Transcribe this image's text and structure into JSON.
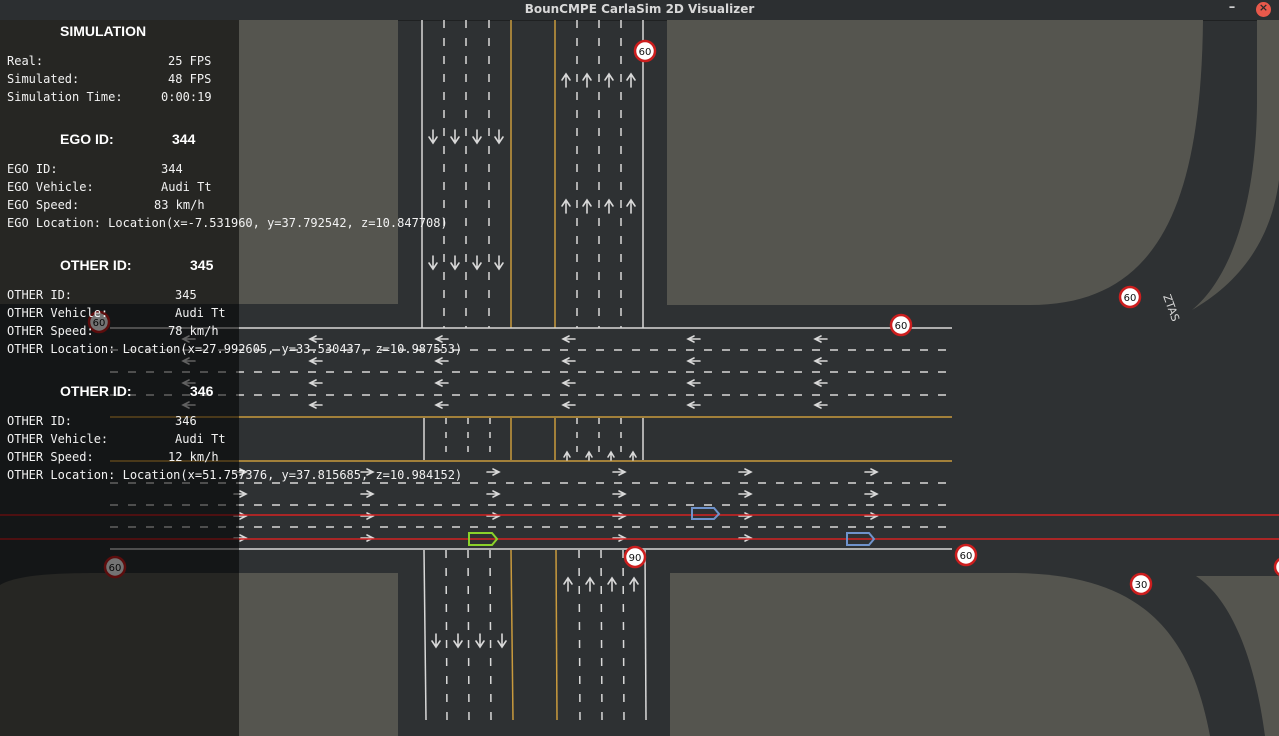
{
  "window": {
    "title": "BounCMPE CarlaSim 2D Visualizer",
    "minimize_glyph": "–",
    "close_glyph": "×"
  },
  "hud": {
    "simulation": {
      "title": "SIMULATION",
      "rows": [
        {
          "label": "Real:",
          "value": "25 FPS"
        },
        {
          "label": "Simulated:",
          "value": "48 FPS"
        },
        {
          "label": "Simulation Time:",
          "value": "0:00:19"
        }
      ]
    },
    "ego": {
      "title": "EGO ID:",
      "title_value": "344",
      "rows": [
        {
          "label": "EGO ID:",
          "value": "344"
        },
        {
          "label": "EGO Vehicle:",
          "value": "Audi Tt"
        },
        {
          "label": "EGO Speed:",
          "value": "83 km/h"
        }
      ],
      "location": "EGO Location: Location(x=-7.531960, y=37.792542, z=10.847708)"
    },
    "others": [
      {
        "title": "OTHER ID:",
        "title_value": "345",
        "rows": [
          {
            "label": "OTHER ID:",
            "value": "345"
          },
          {
            "label": "OTHER Vehicle:",
            "value": "Audi Tt"
          },
          {
            "label": "OTHER Speed:",
            "value": "78 km/h"
          }
        ],
        "location": "OTHER Location: Location(x=27.992605, y=33.530437, z=10.987553)"
      },
      {
        "title": "OTHER ID:",
        "title_value": "346",
        "rows": [
          {
            "label": "OTHER ID:",
            "value": "346"
          },
          {
            "label": "OTHER Vehicle:",
            "value": "Audi Tt"
          },
          {
            "label": "OTHER Speed:",
            "value": "12 km/h"
          }
        ],
        "location": "OTHER Location: Location(x=51.757376, y=37.815685, z=10.984152)"
      }
    ]
  },
  "map": {
    "speed_signs": [
      "60",
      "60",
      "60",
      "60",
      "60",
      "60",
      "90",
      "30"
    ],
    "road_marking_text": "ZTAS",
    "colors": {
      "road": "#2e3133",
      "land": "#55554f",
      "lane_white": "#d8d8d8",
      "lane_yellow": "#c99a3d",
      "trigger_line": "#d42222",
      "ego_vehicle": "#8ad22a",
      "other_vehicle": "#6f93cc",
      "sign_red": "#cc1e1e"
    },
    "icons": [
      "arrow-up-icon",
      "arrow-down-icon",
      "arrow-left-icon",
      "arrow-right-icon"
    ]
  }
}
